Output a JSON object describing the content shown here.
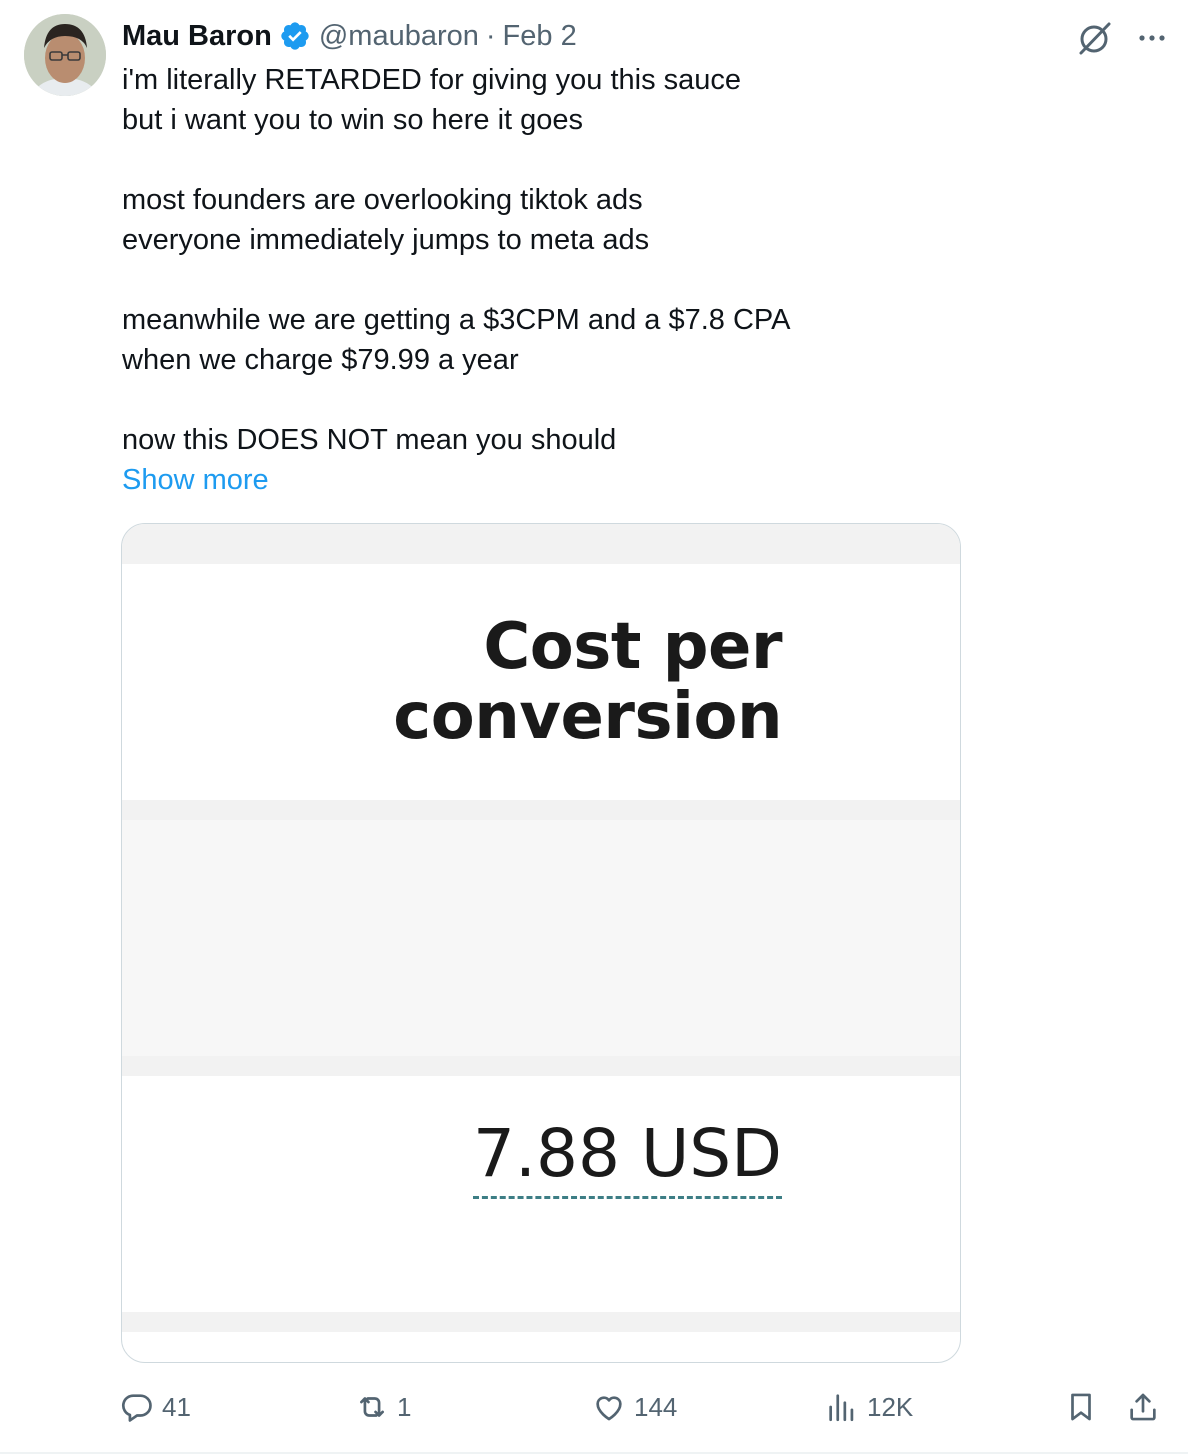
{
  "author": {
    "name": "Mau Baron",
    "handle": "@maubaron",
    "separator": "·",
    "date": "Feb 2",
    "verified": true
  },
  "tweet": {
    "paragraphs": [
      [
        "i'm literally RETARDED for giving you this sauce",
        "but i want you to win so here it goes"
      ],
      [
        "most founders are overlooking tiktok ads",
        "everyone immediately jumps to meta ads"
      ],
      [
        "meanwhile we are getting a $3CPM and a $7.8 CPA",
        "when we charge $79.99 a year"
      ],
      [
        "now this DOES NOT mean you should"
      ]
    ],
    "show_more": "Show more"
  },
  "media": {
    "title_line1": "Cost per",
    "title_line2": "conversion",
    "value": "7.88 USD"
  },
  "actions": {
    "replies": "41",
    "reposts": "1",
    "likes": "144",
    "views": "12K"
  },
  "icons": {
    "verified": "verified-badge-icon",
    "grok": "grok-icon",
    "more": "more-icon",
    "reply": "reply-icon",
    "repost": "repost-icon",
    "like": "heart-icon",
    "views": "views-icon",
    "bookmark": "bookmark-icon",
    "share": "share-icon"
  },
  "colors": {
    "accent": "#1d9bf0",
    "muted": "#536471",
    "text": "#0f1419"
  }
}
